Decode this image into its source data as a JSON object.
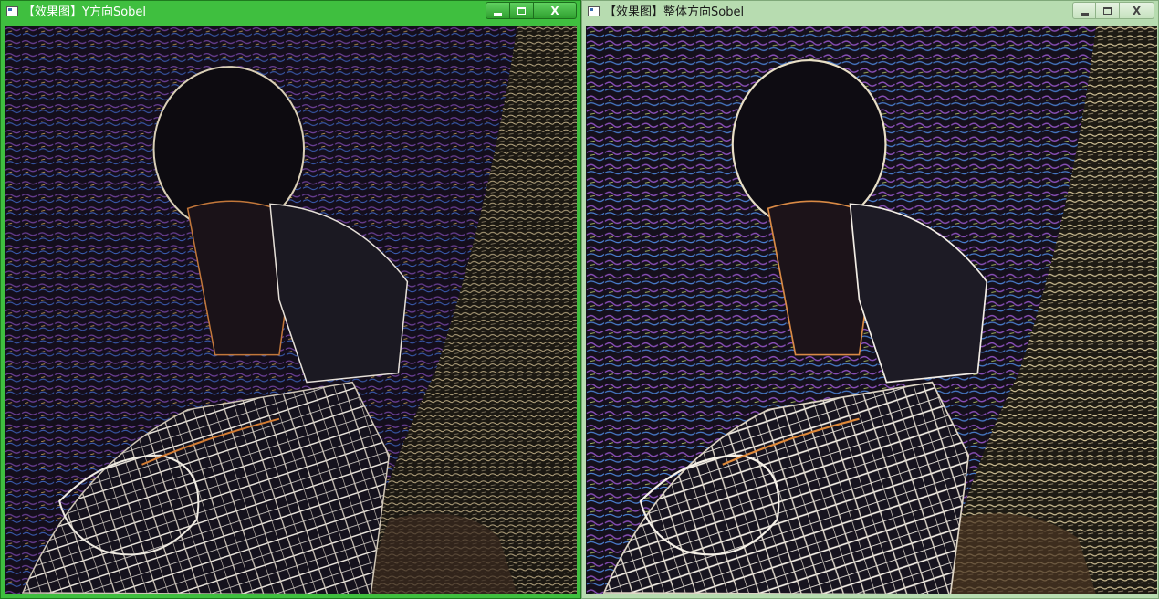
{
  "windows": [
    {
      "title": "【效果图】Y方向Sobel",
      "state": "active",
      "controls": {
        "minimize": "_",
        "maximize": "□",
        "close": "X"
      }
    },
    {
      "title": "【效果图】整体方向Sobel",
      "state": "inactive",
      "controls": {
        "minimize": "_",
        "maximize": "□",
        "close": "X"
      }
    }
  ],
  "colors": {
    "active_frame": "#3fbf3f",
    "inactive_frame": "#b7dcb0",
    "image_background": "#0c0a10",
    "edge_white": "#f2eee6",
    "edge_purple": "#7a4aa8",
    "edge_orange": "#e08a3a",
    "edge_blue": "#3a6ad0"
  }
}
